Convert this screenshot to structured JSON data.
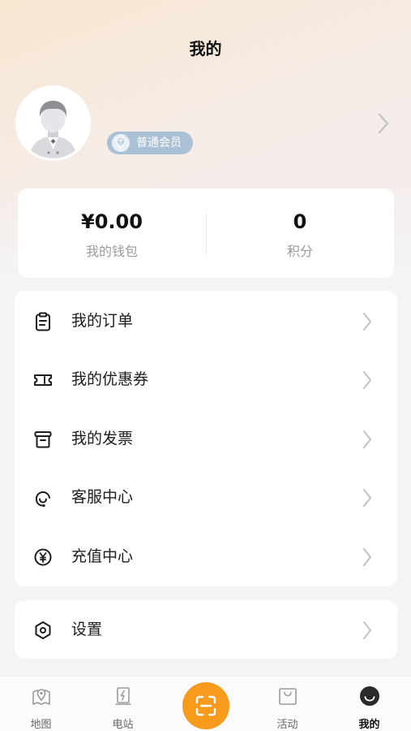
{
  "header": {
    "title": "我的"
  },
  "profile": {
    "member_label": "普通会员",
    "avatar_icon": "default-avatar",
    "badge_color": "#aac0d4"
  },
  "stats": [
    {
      "value": "¥0.00",
      "label": "我的钱包"
    },
    {
      "value": "0",
      "label": "积分"
    }
  ],
  "menu": [
    {
      "label": "我的订单",
      "icon": "clipboard-icon"
    },
    {
      "label": "我的优惠券",
      "icon": "ticket-icon"
    },
    {
      "label": "我的发票",
      "icon": "invoice-icon"
    },
    {
      "label": "客服中心",
      "icon": "headset-icon"
    },
    {
      "label": "充值中心",
      "icon": "yen-coin-icon"
    }
  ],
  "settings": {
    "label": "设置",
    "icon": "hexagon-gear-icon"
  },
  "tabbar": {
    "accent": "#f89b1c",
    "tabs": [
      {
        "label": "地图",
        "icon": "map-pin-icon"
      },
      {
        "label": "电站",
        "icon": "charging-station-icon"
      },
      {
        "label": "",
        "icon": "scan-icon"
      },
      {
        "label": "活动",
        "icon": "shopping-bag-icon"
      },
      {
        "label": "我的",
        "icon": "profile-smile-icon",
        "active": true
      }
    ]
  }
}
